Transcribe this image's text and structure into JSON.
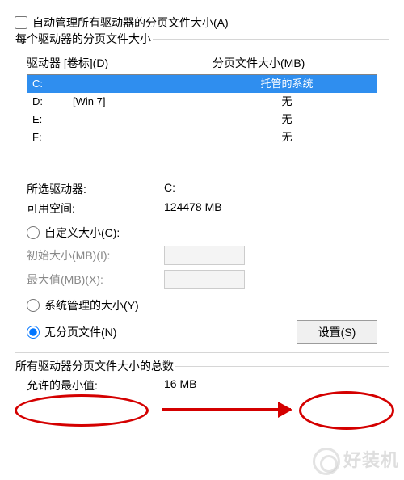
{
  "auto_manage": {
    "label": "自动管理所有驱动器的分页文件大小(A)",
    "checked": false
  },
  "per_drive": {
    "legend": "每个驱动器的分页文件大小",
    "col_drive": "驱动器 [卷标](D)",
    "col_size": "分页文件大小(MB)",
    "rows": [
      {
        "drive": "C:",
        "label": "",
        "size": "托管的系统",
        "selected": true
      },
      {
        "drive": "D:",
        "label": "[Win 7]",
        "size": "无",
        "selected": false
      },
      {
        "drive": "E:",
        "label": "",
        "size": "无",
        "selected": false
      },
      {
        "drive": "F:",
        "label": "",
        "size": "无",
        "selected": false
      }
    ],
    "selected_drive_label": "所选驱动器:",
    "selected_drive_value": "C:",
    "free_space_label": "可用空间:",
    "free_space_value": "124478 MB",
    "custom_radio": "自定义大小(C):",
    "initial_label": "初始大小(MB)(I):",
    "max_label": "最大值(MB)(X):",
    "system_radio": "系统管理的大小(Y)",
    "none_radio": "无分页文件(N)",
    "set_button": "设置(S)",
    "radio_value": "none"
  },
  "total": {
    "legend": "所有驱动器分页文件大小的总数",
    "min_label": "允许的最小值:",
    "min_value": "16 MB"
  },
  "watermark": "好装机"
}
